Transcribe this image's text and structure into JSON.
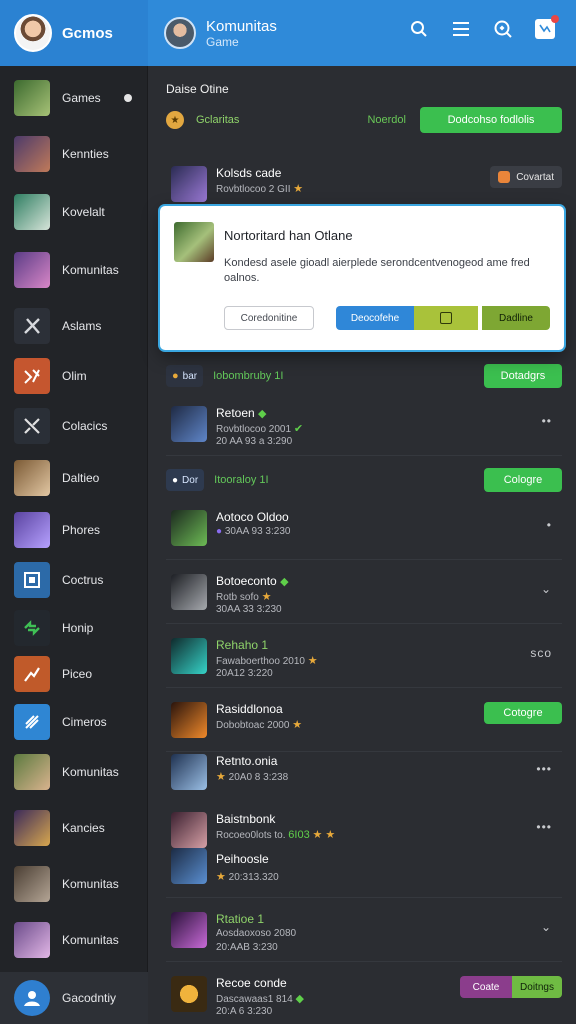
{
  "header": {
    "brand": "Gcmos",
    "title": "Komunitas",
    "subtitle": "Game",
    "icons": [
      "search-icon",
      "menu-icon",
      "discover-icon",
      "notification-icon"
    ]
  },
  "sidebar": {
    "items": [
      {
        "label": "Games",
        "thumb": "#6a8f4c"
      },
      {
        "label": "Kennties",
        "thumb": "#4c3a6a"
      },
      {
        "label": "Kovelalt",
        "thumb": "#2f7e62"
      },
      {
        "label": "Komunitas",
        "thumb": "#5b3c86"
      },
      {
        "label": "Aslams",
        "thumb": "#2c3038"
      },
      {
        "label": "Olim",
        "thumb": "#c5562f"
      },
      {
        "label": "Colacics",
        "thumb": "#2a2f37"
      },
      {
        "label": "Daltieo",
        "thumb": "#7b5a35"
      },
      {
        "label": "Phores",
        "thumb": "#5a43a0"
      },
      {
        "label": "Coctrus",
        "thumb": "#2c6aa8"
      },
      {
        "label": "Honip",
        "thumb": "#2a8a3c"
      },
      {
        "label": "Piceo",
        "thumb": "#c05a2a"
      },
      {
        "label": "Cimeros",
        "thumb": "#2f86d3"
      },
      {
        "label": "Komunitas",
        "thumb": "#5c7a3f"
      },
      {
        "label": "Kancies",
        "thumb": "#3b2a5a"
      },
      {
        "label": "Komunitas",
        "thumb": "#4a3e33"
      },
      {
        "label": "Komunitas",
        "thumb": "#6b4b8a"
      }
    ],
    "footer_label": "Gacodntiy"
  },
  "main": {
    "section_title": "Daise Otine",
    "filter": {
      "label": "Gclaritas",
      "mid": "Noerdol",
      "button": "Dodcohso fodlolis"
    },
    "rows": [
      {
        "name": "Kolsds cade",
        "sub": "Rovbtlocoo 2 GII",
        "time": "",
        "badge": "Covartat"
      },
      {
        "name": "Retoen",
        "sub": "Rovbtlocoo 2001",
        "time": "20 AA 93 a 3:290"
      },
      {
        "name": "Aotoco Oldoo",
        "sub": "",
        "time": "30AA 93 3:230"
      },
      {
        "name": "Botoeconto",
        "sub": "Rotb sofo",
        "time": "30AA 33 3:230"
      },
      {
        "name": "Rehaho 1",
        "sub": "Fawaboerthoo 2010",
        "time": "20A12 3:220"
      },
      {
        "name": "Rasiddlonoa",
        "sub": "Dobobtoac 2000",
        "time": ""
      },
      {
        "name": "Retnto.onia",
        "sub": "",
        "time": "20A0 8 3:238"
      },
      {
        "name": "Baistnbonk",
        "sub": "Rocoeo0lots to.",
        "time": ""
      },
      {
        "name": "Peihoosle",
        "sub": "",
        "time": "20:313.320"
      },
      {
        "name": "Rtatioe 1",
        "sub": "Aosdaoxoso 2080",
        "time": "20:AAB 3:230"
      },
      {
        "name": "Recoe conde",
        "sub": "Dascawaas1 814",
        "time": "20:A 6 3:230"
      }
    ],
    "groups": [
      {
        "chip": "bar",
        "label": "Iobombruby 1I",
        "button": "Dotadgrs"
      },
      {
        "chip": "Dor",
        "label": "Itooraloy 1I",
        "button": "Cologre"
      }
    ],
    "extra": {
      "badge_green": "Cotogre",
      "split_a": "Coate",
      "split_b": "Doitngs",
      "row_tag": "6I03",
      "more_text": "sco"
    }
  },
  "modal": {
    "title": "Nortoritard han Otlane",
    "text": "Kondesd asele gioadl aierplede serondcentvenogeod ame fred oalnos.",
    "btn_outline": "Coredonitine",
    "btn_blue": "Deocofehe",
    "btn_green": "Dadline"
  }
}
